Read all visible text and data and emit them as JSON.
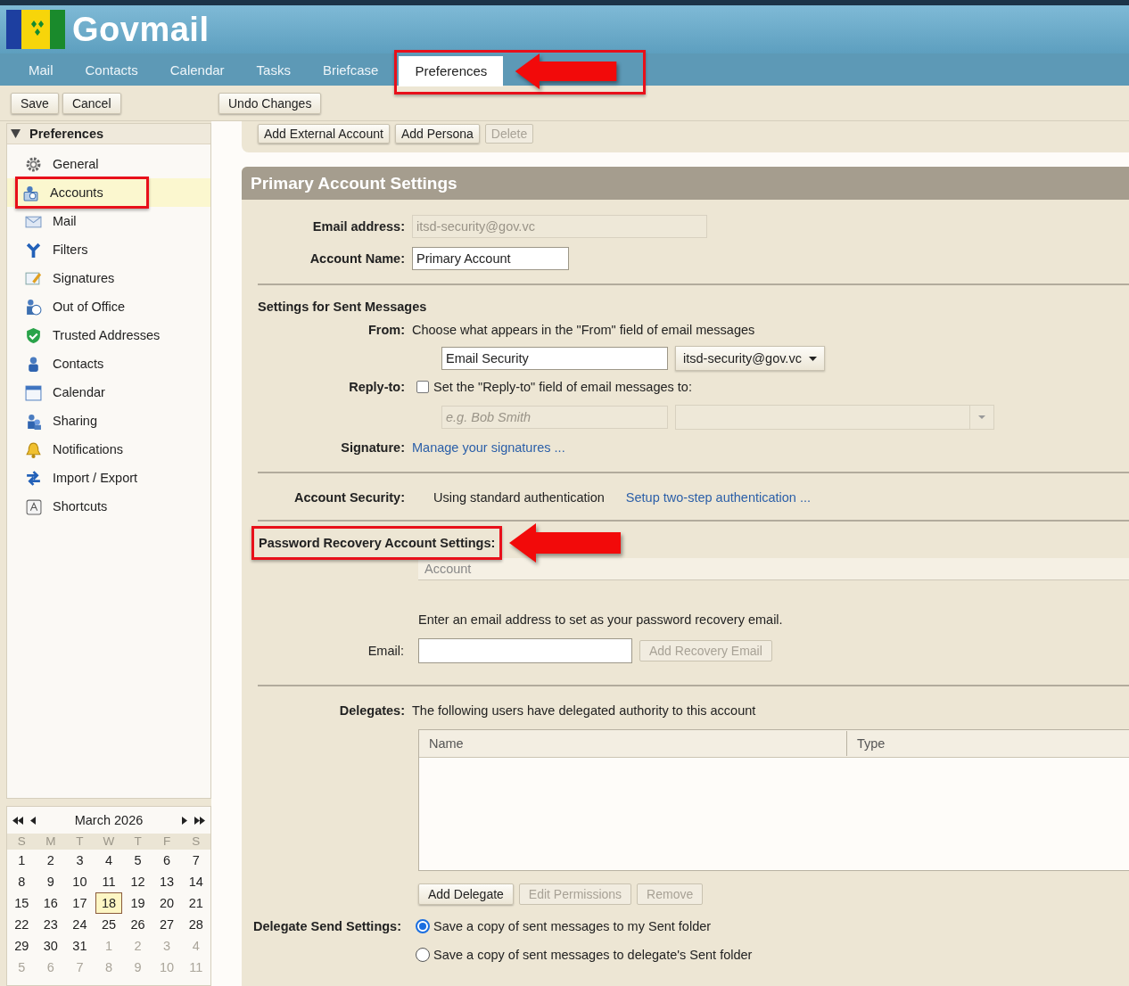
{
  "app": {
    "name": "Govmail"
  },
  "tabs": [
    {
      "label": "Mail",
      "selected": false,
      "highlighted": false
    },
    {
      "label": "Contacts",
      "selected": false,
      "highlighted": false
    },
    {
      "label": "Calendar",
      "selected": false,
      "highlighted": false
    },
    {
      "label": "Tasks",
      "selected": false,
      "highlighted": false
    },
    {
      "label": "Briefcase",
      "selected": false,
      "highlighted": false
    },
    {
      "label": "Preferences",
      "selected": true,
      "highlighted": true
    }
  ],
  "toolbar": {
    "left_buttons": [
      "Save",
      "Cancel"
    ],
    "right_buttons": [
      "Undo Changes"
    ]
  },
  "sidebar": {
    "header": "Preferences",
    "expanded": true,
    "items": [
      {
        "label": "General",
        "selected": false,
        "highlighted": false
      },
      {
        "label": "Accounts",
        "selected": true,
        "highlighted": true
      },
      {
        "label": "Mail",
        "selected": false,
        "highlighted": false
      },
      {
        "label": "Filters",
        "selected": false,
        "highlighted": false
      },
      {
        "label": "Signatures",
        "selected": false,
        "highlighted": false
      },
      {
        "label": "Out of Office",
        "selected": false,
        "highlighted": false
      },
      {
        "label": "Trusted Addresses",
        "selected": false,
        "highlighted": false
      },
      {
        "label": "Contacts",
        "selected": false,
        "highlighted": false
      },
      {
        "label": "Calendar",
        "selected": false,
        "highlighted": false
      },
      {
        "label": "Sharing",
        "selected": false,
        "highlighted": false
      },
      {
        "label": "Notifications",
        "selected": false,
        "highlighted": false
      },
      {
        "label": "Import / Export",
        "selected": false,
        "highlighted": false
      },
      {
        "label": "Shortcuts",
        "selected": false,
        "highlighted": false
      }
    ]
  },
  "mini_calendar": {
    "title": "March 2026",
    "weekdays": [
      "S",
      "M",
      "T",
      "W",
      "T",
      "F",
      "S"
    ],
    "weeks": [
      [
        {
          "day": "1",
          "current_month": true,
          "today": false
        },
        {
          "day": "2",
          "current_month": true,
          "today": false
        },
        {
          "day": "3",
          "current_month": true,
          "today": false
        },
        {
          "day": "4",
          "current_month": true,
          "today": false
        },
        {
          "day": "5",
          "current_month": true,
          "today": false
        },
        {
          "day": "6",
          "current_month": true,
          "today": false
        },
        {
          "day": "7",
          "current_month": true,
          "today": false
        }
      ],
      [
        {
          "day": "8",
          "current_month": true,
          "today": false
        },
        {
          "day": "9",
          "current_month": true,
          "today": false
        },
        {
          "day": "10",
          "current_month": true,
          "today": false
        },
        {
          "day": "11",
          "current_month": true,
          "today": false
        },
        {
          "day": "12",
          "current_month": true,
          "today": false
        },
        {
          "day": "13",
          "current_month": true,
          "today": false
        },
        {
          "day": "14",
          "current_month": true,
          "today": false
        }
      ],
      [
        {
          "day": "15",
          "current_month": true,
          "today": false
        },
        {
          "day": "16",
          "current_month": true,
          "today": false
        },
        {
          "day": "17",
          "current_month": true,
          "today": false
        },
        {
          "day": "18",
          "current_month": true,
          "today": true
        },
        {
          "day": "19",
          "current_month": true,
          "today": false
        },
        {
          "day": "20",
          "current_month": true,
          "today": false
        },
        {
          "day": "21",
          "current_month": true,
          "today": false
        }
      ],
      [
        {
          "day": "22",
          "current_month": true,
          "today": false
        },
        {
          "day": "23",
          "current_month": true,
          "today": false
        },
        {
          "day": "24",
          "current_month": true,
          "today": false
        },
        {
          "day": "25",
          "current_month": true,
          "today": false
        },
        {
          "day": "26",
          "current_month": true,
          "today": false
        },
        {
          "day": "27",
          "current_month": true,
          "today": false
        },
        {
          "day": "28",
          "current_month": true,
          "today": false
        }
      ],
      [
        {
          "day": "29",
          "current_month": true,
          "today": false
        },
        {
          "day": "30",
          "current_month": true,
          "today": false
        },
        {
          "day": "31",
          "current_month": true,
          "today": false
        },
        {
          "day": "1",
          "current_month": false,
          "today": false
        },
        {
          "day": "2",
          "current_month": false,
          "today": false
        },
        {
          "day": "3",
          "current_month": false,
          "today": false
        },
        {
          "day": "4",
          "current_month": false,
          "today": false
        }
      ],
      [
        {
          "day": "5",
          "current_month": false,
          "today": false
        },
        {
          "day": "6",
          "current_month": false,
          "today": false
        },
        {
          "day": "7",
          "current_month": false,
          "today": false
        },
        {
          "day": "8",
          "current_month": false,
          "today": false
        },
        {
          "day": "9",
          "current_month": false,
          "today": false
        },
        {
          "day": "10",
          "current_month": false,
          "today": false
        },
        {
          "day": "11",
          "current_month": false,
          "today": false
        }
      ]
    ]
  },
  "content": {
    "top_buttons": [
      {
        "label": "Add External Account",
        "disabled": false
      },
      {
        "label": "Add Persona",
        "disabled": false
      },
      {
        "label": "Delete",
        "disabled": true
      }
    ],
    "primary": {
      "title": "Primary Account Settings",
      "email_label": "Email address:",
      "email_value": "itsd-security@gov.vc",
      "account_name_label": "Account Name:",
      "account_name_value": "Primary Account"
    },
    "sent": {
      "heading": "Settings for Sent Messages",
      "from_label": "From:",
      "from_hint": "Choose what appears in the \"From\" field of email messages",
      "from_name": "Email Security",
      "from_address": "itsd-security@gov.vc",
      "reply_label": "Reply-to:",
      "reply_checked": false,
      "reply_text": "Set the \"Reply-to\" field of email messages to:",
      "reply_name_placeholder": "e.g. Bob Smith",
      "signature_label": "Signature:",
      "signature_link": "Manage your signatures ..."
    },
    "security": {
      "label": "Account Security:",
      "value": "Using standard authentication",
      "link": "Setup two-step authentication ..."
    },
    "recovery": {
      "heading": "Password Recovery Account Settings:",
      "highlighted": true,
      "column": "Account",
      "instructions": "Enter an email address to set as your password recovery email.",
      "email_label": "Email:",
      "add_button": {
        "label": "Add Recovery Email",
        "disabled": true
      }
    },
    "delegates": {
      "label": "Delegates:",
      "text": "The following users have delegated authority to this account",
      "columns": [
        "Name",
        "Type"
      ],
      "buttons": [
        {
          "label": "Add Delegate",
          "disabled": false
        },
        {
          "label": "Edit Permissions",
          "disabled": true
        },
        {
          "label": "Remove",
          "disabled": true
        }
      ],
      "send_label": "Delegate Send Settings:",
      "send_options": [
        {
          "label": "Save a copy of sent messages to my Sent folder",
          "selected": true
        },
        {
          "label": "Save a copy of sent messages to delegate's Sent folder",
          "selected": false
        }
      ]
    }
  }
}
